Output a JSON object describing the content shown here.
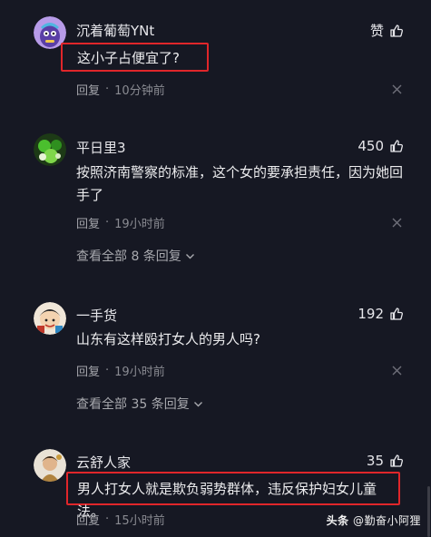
{
  "comments": [
    {
      "user": "沉着葡萄YNt",
      "likes": "赞",
      "text": "这小子占便宜了?",
      "reply": "回复",
      "sep": "·",
      "time": "10分钟前"
    },
    {
      "user": "平日里3",
      "likes": "450",
      "text": "按照济南警察的标准，这个女的要承担责任，因为她回手了",
      "reply": "回复",
      "sep": "·",
      "time": "19小时前",
      "more": "查看全部 8 条回复"
    },
    {
      "user": "一手货",
      "likes": "192",
      "text": "山东有这样殴打女人的男人吗?",
      "reply": "回复",
      "sep": "·",
      "time": "19小时前",
      "more": "查看全部 35 条回复"
    },
    {
      "user": "云舒人家",
      "likes": "35",
      "text": "男人打女人就是欺负弱势群体，违反保护妇女儿童法。",
      "reply": "回复",
      "sep": "·",
      "time": "15小时前"
    }
  ],
  "watermark": {
    "platform": "头条",
    "author": "@勤奋小阿狸"
  },
  "colors": {
    "background": "#161823",
    "highlight_border": "#e0262a",
    "muted_text": "#8a8b92"
  },
  "icons": {
    "like": "thumbs-up-icon",
    "close": "close-icon",
    "expand": "chevron-down-icon"
  }
}
